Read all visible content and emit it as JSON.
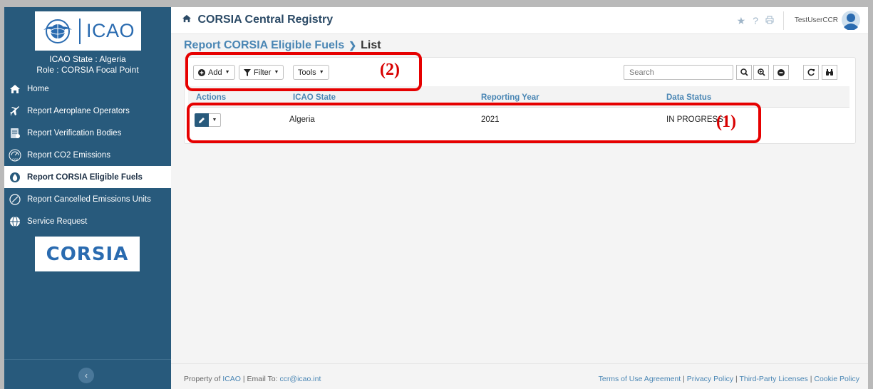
{
  "sidebar": {
    "logo_text": "ICAO",
    "state_label": "ICAO State : Algeria",
    "role_label": "Role : CORSIA Focal Point",
    "items": [
      {
        "label": "Home",
        "icon": "home-icon"
      },
      {
        "label": "Report Aeroplane Operators",
        "icon": "airplane-icon"
      },
      {
        "label": "Report Verification Bodies",
        "icon": "document-icon"
      },
      {
        "label": "Report CO2 Emissions",
        "icon": "co2-gauge-icon"
      },
      {
        "label": "Report CORSIA Eligible Fuels",
        "icon": "fuel-drop-icon"
      },
      {
        "label": "Report Cancelled Emissions Units",
        "icon": "cancelled-circle-icon"
      },
      {
        "label": "Service Request",
        "icon": "globe-icon"
      }
    ],
    "corsia_logo": "CORSIA",
    "collapse_icon": "chevron-left-icon"
  },
  "topbar": {
    "title": "CORSIA Central Registry",
    "username": "TestUserCCR"
  },
  "breadcrumb": {
    "parent": "Report CORSIA Eligible Fuels",
    "current": "List"
  },
  "toolbar": {
    "add_label": "Add",
    "filter_label": "Filter",
    "tools_label": "Tools",
    "search_placeholder": "Search"
  },
  "table": {
    "columns": [
      "Actions",
      "ICAO State",
      "Reporting Year",
      "Data Status"
    ],
    "rows": [
      {
        "icao_state": "Algeria",
        "reporting_year": "2021",
        "data_status": "IN PROGRESS"
      }
    ]
  },
  "annotations": {
    "label_1": "(1)",
    "label_2": "(2)",
    "color": "#e60000"
  },
  "footer": {
    "property_of": "Property of",
    "icao": "ICAO",
    "email_sep": "| Email To:",
    "email": "ccr@icao.int",
    "terms": "Terms of Use Agreement",
    "privacy": "Privacy Policy",
    "third_party": "Third-Party Licenses",
    "cookie": "Cookie Policy",
    "sep": "|"
  },
  "colors": {
    "sidebar_bg": "#285a7c",
    "accent": "#4a86b4",
    "brand_blue": "#2a6bb0"
  }
}
